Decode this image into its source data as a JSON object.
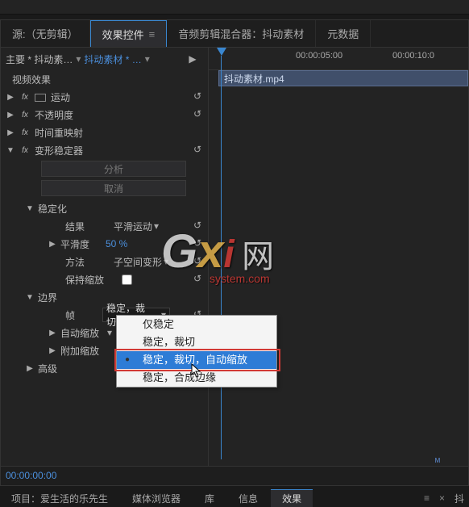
{
  "tabs": {
    "source": "源:（无剪辑）",
    "effectControls": "效果控件",
    "audioMixer": "音频剪辑混合器：抖动素材",
    "metadata": "元数据"
  },
  "clip": {
    "master": "主要 * 抖动素…",
    "sequence": "抖动素材 * …",
    "filename": "抖动素材.mp4"
  },
  "sections": {
    "videoEffects": "视频效果"
  },
  "effects": {
    "motion": "运动",
    "opacity": "不透明度",
    "timeRemap": "时间重映射",
    "warpStabilizer": "变形稳定器"
  },
  "warp": {
    "analyze": "分析",
    "cancel": "取消",
    "stabilization": "稳定化",
    "result": "结果",
    "resultVal": "平滑运动",
    "smoothness": "平滑度",
    "smoothnessVal": "50 %",
    "method": "方法",
    "methodVal": "子空间变形",
    "preserveScale": "保持缩放",
    "borders": "边界",
    "frame": "帧",
    "frameVal": "稳定，裁切，",
    "autoScale": "自动缩放",
    "addlScale": "附加缩放",
    "advanced": "高级"
  },
  "dropdown": {
    "opt1": "仅稳定",
    "opt2": "稳定，裁切",
    "opt3": "稳定，裁切，自动缩放",
    "opt4": "稳定，合成边缘"
  },
  "timeline": {
    "t1": "00:00:05:00",
    "t2": "00:00:10:0"
  },
  "timecode": "00:00:00:00",
  "bottom": {
    "project": "项目：爱生活的乐先生",
    "mediaBrowser": "媒体浏览器",
    "library": "库",
    "info": "信息",
    "effects": "效果",
    "seqName": "抖"
  },
  "watermark": {
    "net": "网",
    "sub": "system.com"
  }
}
